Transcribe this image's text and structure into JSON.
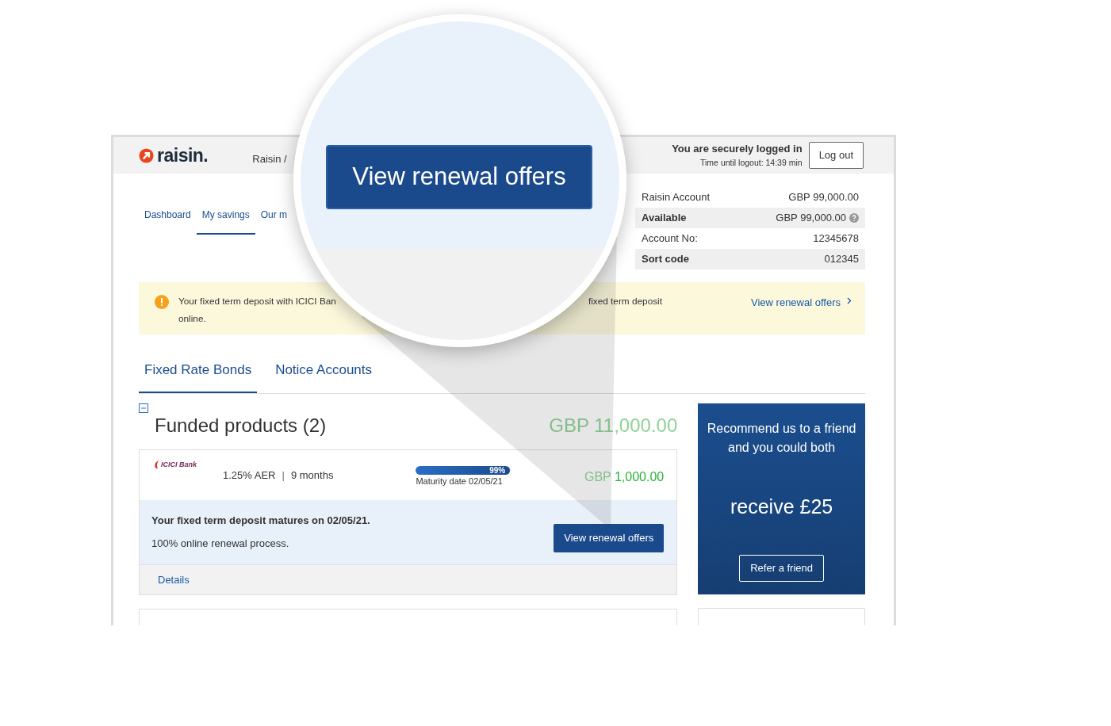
{
  "header": {
    "logo_text": "raisin.",
    "nav_partial": "Raisin /",
    "login_status": "You are securely logged in",
    "logout_timer": "Time until logout: 14:39 min",
    "logout_button": "Log out"
  },
  "nav": [
    {
      "label": "Dashboard",
      "selected": false
    },
    {
      "label": "My savings",
      "selected": true
    },
    {
      "label": "Our m",
      "selected": false
    }
  ],
  "account_summary": [
    {
      "label": "Raisin Account",
      "value": "GBP 99,000.00",
      "highlighted": false,
      "help": false
    },
    {
      "label": "Available",
      "value": "GBP 99,000.00",
      "highlighted": true,
      "help": true
    },
    {
      "label": "Account No:",
      "value": "12345678",
      "highlighted": false,
      "help": false
    },
    {
      "label": "Sort code",
      "value": "012345",
      "highlighted": true,
      "help": false
    }
  ],
  "alert": {
    "text_start": "Your fixed term deposit with ICICI Ban",
    "text_end": "fixed term deposit",
    "text_second_line": "online.",
    "link": "View renewal offers"
  },
  "product_tabs": [
    {
      "label": "Fixed Rate Bonds",
      "selected": true
    },
    {
      "label": "Notice Accounts",
      "selected": false
    }
  ],
  "funded": {
    "title": "Funded products (2)",
    "expanded": true,
    "total_currency": "GBP",
    "total_amount": "11,000.00"
  },
  "products": [
    {
      "bank": "ICICI Bank",
      "rate": "1.25% AER",
      "separator": "|",
      "term": "9 months",
      "level": 0.99,
      "progress_label": "99%",
      "maturity": "Maturity date 02/05/21",
      "currency": "GBP",
      "amount": "1,000.00",
      "notice_title": "Your fixed term deposit matures on 02/05/21.",
      "notice_text": "100% online renewal process.",
      "button": "View renewal offers",
      "details": "Details"
    }
  ],
  "promo": {
    "text": "Recommend us to a friend and you could both",
    "highlight": "receive £25",
    "button": "Refer a friend"
  },
  "magnifier": {
    "button": "View renewal offers"
  }
}
